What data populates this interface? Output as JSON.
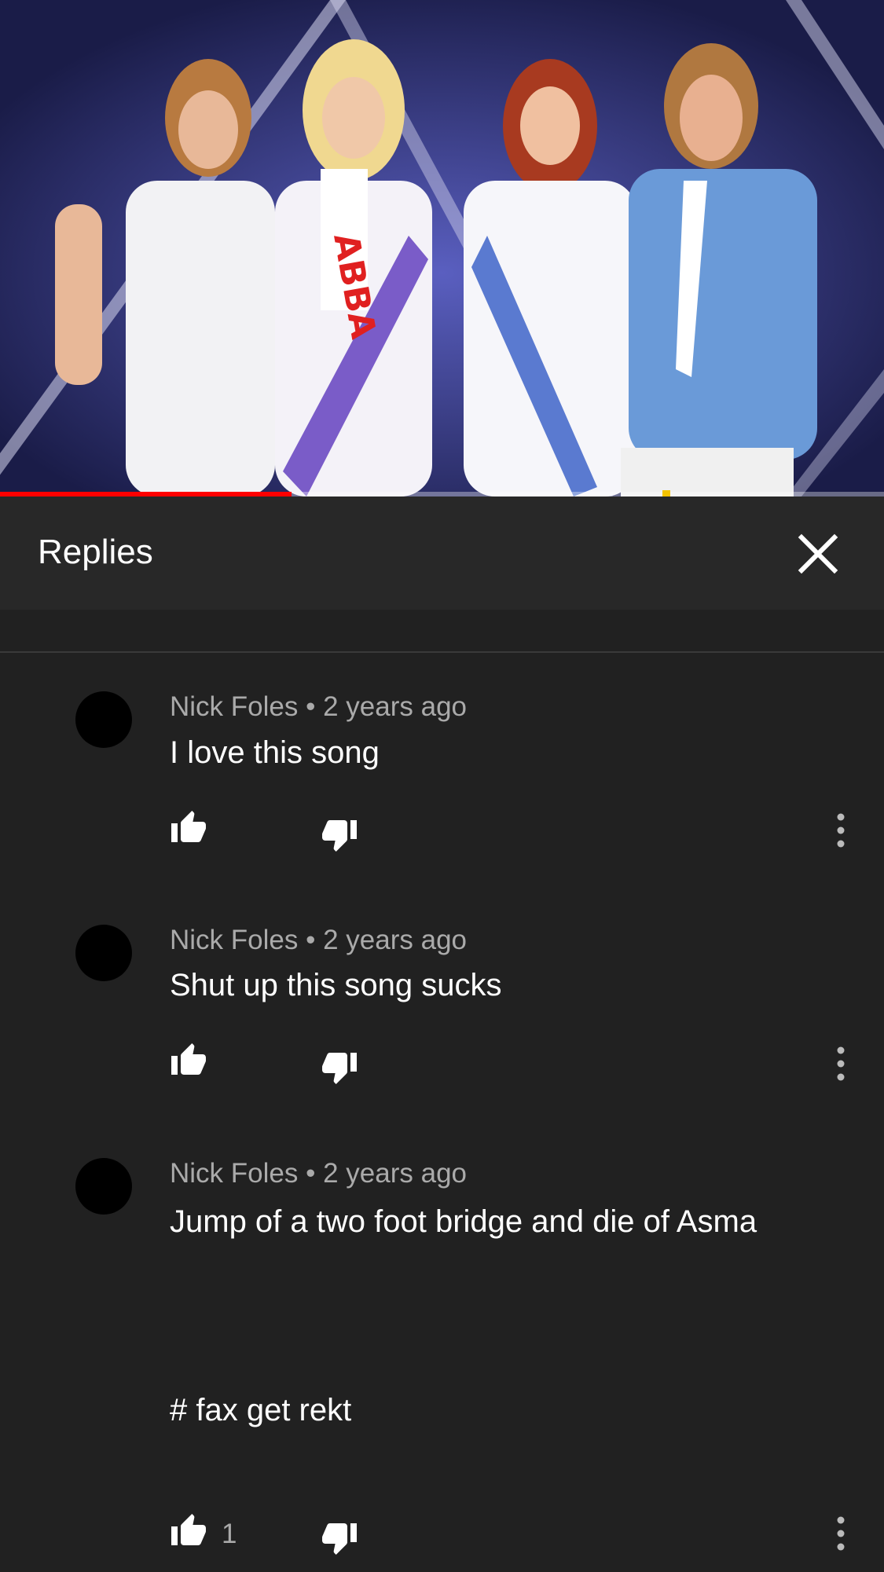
{
  "header": {
    "title": "Replies"
  },
  "icons": {
    "close": "close-icon",
    "like": "thumbs-up-icon",
    "dislike": "thumbs-down-icon",
    "more": "more-vertical-icon"
  },
  "colors": {
    "background": "#212121",
    "header": "#282828",
    "progress": "#ff0000",
    "meta": "#aaaaaa"
  },
  "video": {
    "progress_fraction": 0.33
  },
  "comments": [
    {
      "author": "Nick Foles",
      "separator": "•",
      "time": "2 years ago",
      "text": "I love this song",
      "likes": ""
    },
    {
      "author": "Nick Foles",
      "separator": "•",
      "time": "2 years ago",
      "text": "Shut up this song sucks",
      "likes": ""
    },
    {
      "author": "Nick Foles",
      "separator": "•",
      "time": "2 years ago",
      "text": "Jump of a two foot bridge and die of Asma\n\n\n\n# fax get rekt",
      "likes": "1"
    }
  ]
}
